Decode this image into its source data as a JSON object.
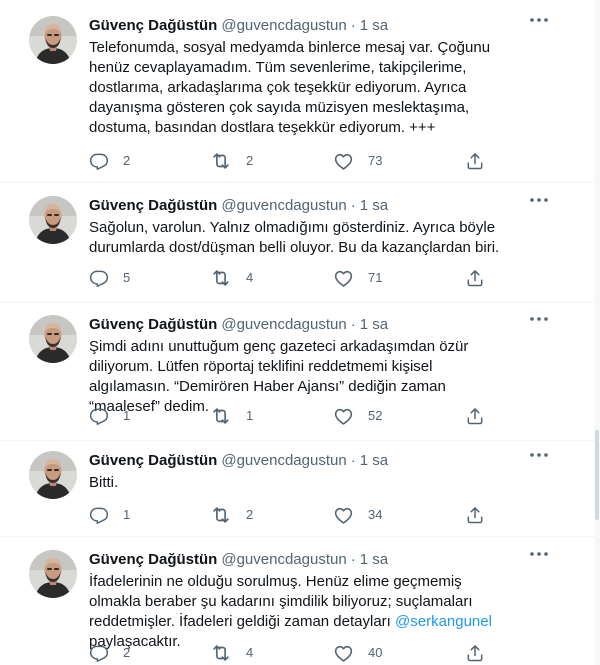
{
  "tweets": [
    {
      "name": "Güvenç Dağüstün",
      "handle": "@guvencdagustun",
      "dot": "·",
      "time": "1 sa",
      "text": "Telefonumda, sosyal medyamda binlerce mesaj var. Çoğunu henüz cevaplayamadım. Tüm sevenlerime, takipçilerime, dostlarıma, arkadaşlarıma çok teşekkür ediyorum. Ayrıca dayanışma gösteren çok sayıda müzisyen meslektaşıma, dostuma, basından dostlara teşekkür ediyorum. +++",
      "replies": "2",
      "retweets": "2",
      "likes": "73"
    },
    {
      "name": "Güvenç Dağüstün",
      "handle": "@guvencdagustun",
      "dot": "·",
      "time": "1 sa",
      "text": "Sağolun, varolun. Yalnız olmadığımı gösterdiniz. Ayrıca böyle durumlarda dost/düşman belli oluyor. Bu da kazançlardan biri.",
      "replies": "5",
      "retweets": "4",
      "likes": "71"
    },
    {
      "name": "Güvenç Dağüstün",
      "handle": "@guvencdagustun",
      "dot": "·",
      "time": "1 sa",
      "text": "Şimdi adını unuttuğum genç gazeteci arkadaşımdan özür diliyorum. Lütfen röportaj teklifini reddetmemi kişisel algılamasın. “Demirören Haber Ajansı” dediğin zaman “maalesef” dedim.",
      "replies": "1",
      "retweets": "1",
      "likes": "52"
    },
    {
      "name": "Güvenç Dağüstün",
      "handle": "@guvencdagustun",
      "dot": "·",
      "time": "1 sa",
      "text": "Bitti.",
      "replies": "1",
      "retweets": "2",
      "likes": "34"
    },
    {
      "name": "Güvenç Dağüstün",
      "handle": "@guvencdagustun",
      "dot": "·",
      "time": "1 sa",
      "text_before": "İfadelerinin ne olduğu sorulmuş. Henüz elime geçmemiş olmakla beraber şu kadarını şimdilik biliyoruz; suçlamaları reddetmişler. İfadeleri geldiği zaman detayları ",
      "mention": "@serkangunel",
      "text_after": " paylaşacaktır.",
      "replies": "2",
      "retweets": "4",
      "likes": "40"
    }
  ],
  "icons": {
    "reply": "reply-icon",
    "retweet": "retweet-icon",
    "like": "heart-icon",
    "share": "share-icon",
    "more": "more-icon"
  },
  "colors": {
    "text": "#0f1419",
    "secondary": "#536471",
    "link": "#1d9bf0",
    "separator": "#eff3f4"
  }
}
